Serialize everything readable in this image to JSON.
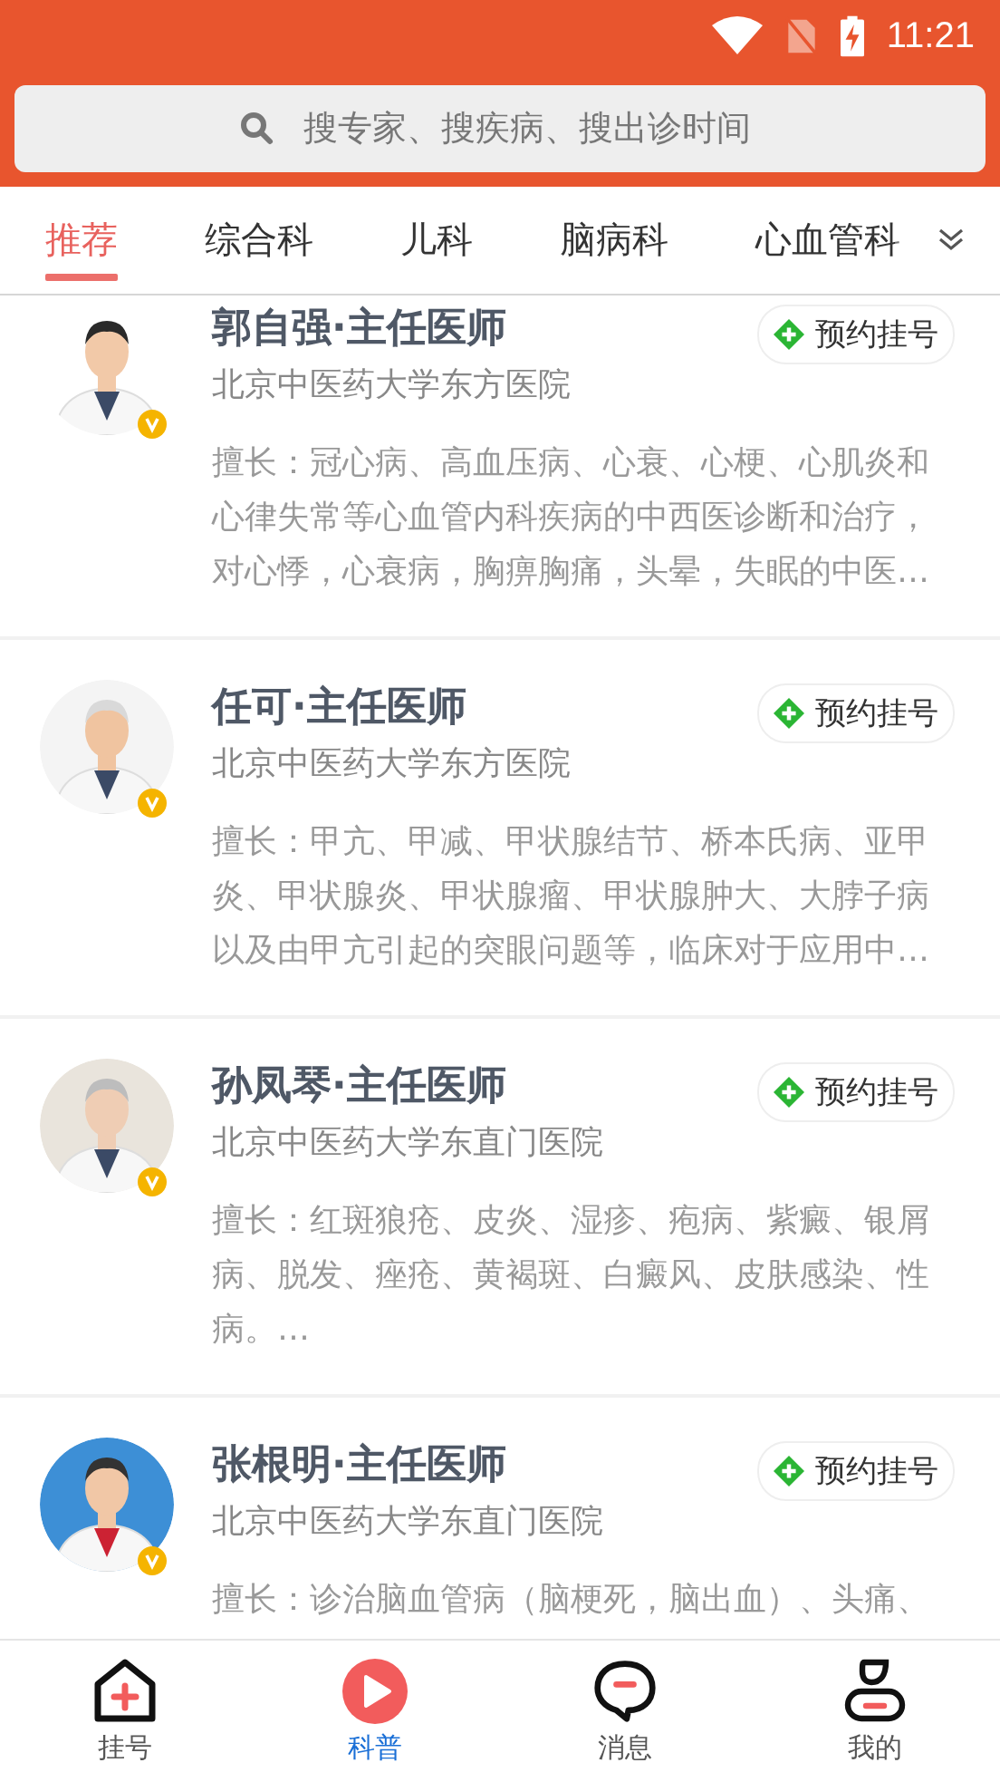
{
  "status_bar": {
    "time": "11:21"
  },
  "search": {
    "placeholder": "搜专家、搜疾病、搜出诊时间"
  },
  "tabs": [
    {
      "label": "推荐",
      "selected": true
    },
    {
      "label": "综合科",
      "selected": false
    },
    {
      "label": "儿科",
      "selected": false
    },
    {
      "label": "脑病科",
      "selected": false
    },
    {
      "label": "心血管科",
      "selected": false
    }
  ],
  "doctors": [
    {
      "name": "郭自强·主任医师",
      "hospital": "北京中医药大学东方医院",
      "button": "预约挂号",
      "description": "擅长：冠心病、高血压病、心衰、心梗、心肌炎和心律失常等心血管内科疾病的中西医诊断和治疗，对心悸，心衰病，胸痹胸痛，头晕，失眠的中医…"
    },
    {
      "name": "任可·主任医师",
      "hospital": "北京中医药大学东方医院",
      "button": "预约挂号",
      "description": "擅长：甲亢、甲减、甲状腺结节、桥本氏病、亚甲炎、甲状腺炎、甲状腺瘤、甲状腺肿大、大脖子病以及由甲亢引起的突眼问题等，临床对于应用中…"
    },
    {
      "name": "孙凤琴·主任医师",
      "hospital": "北京中医药大学东直门医院",
      "button": "预约挂号",
      "description": "擅长：红斑狼疮、皮炎、湿疹、疱病、紫癜、银屑病、脱发、痤疮、黄褐斑、白癜风、皮肤感染、性病。…"
    },
    {
      "name": "张根明·主任医师",
      "hospital": "北京中医药大学东直门医院",
      "button": "预约挂号",
      "description": "擅长：诊治脑血管病（脑梗死，脑出血）、头痛、"
    }
  ],
  "bottom_nav": [
    {
      "label": "挂号",
      "kind": "register",
      "selected": false
    },
    {
      "label": "科普",
      "kind": "science",
      "selected": true
    },
    {
      "label": "消息",
      "kind": "messages",
      "selected": false
    },
    {
      "label": "我的",
      "kind": "profile",
      "selected": false
    }
  ]
}
